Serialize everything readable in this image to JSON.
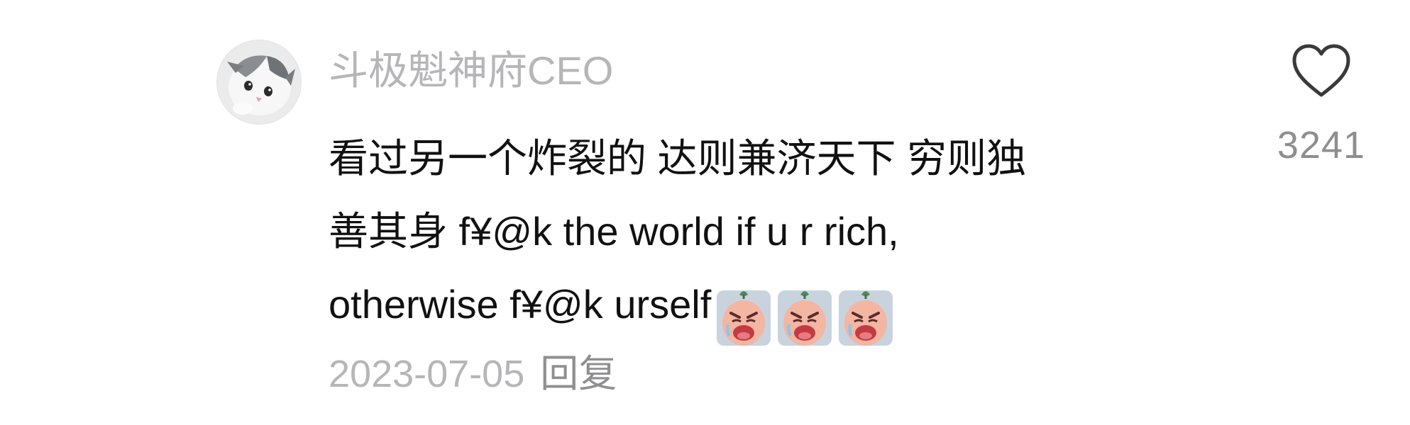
{
  "comment": {
    "username": "斗极魁神府CEO",
    "text_lines": [
      "看过另一个炸裂的 达则兼济天下 穷则独",
      "善其身 f¥@k the world if u r rich,",
      "otherwise f¥@k urself"
    ],
    "emojis": [
      "crying-face-emoji",
      "crying-face-emoji",
      "crying-face-emoji"
    ],
    "date": "2023-07-05",
    "reply_label": "回复",
    "like_count": "3241",
    "avatar_icon": "cat-avatar",
    "like_icon": "heart-outline-icon"
  },
  "colors": {
    "username": "#b6b6b8",
    "body_text": "#111111",
    "meta_text": "#b6b6b8",
    "like_count": "#8e8e90"
  }
}
